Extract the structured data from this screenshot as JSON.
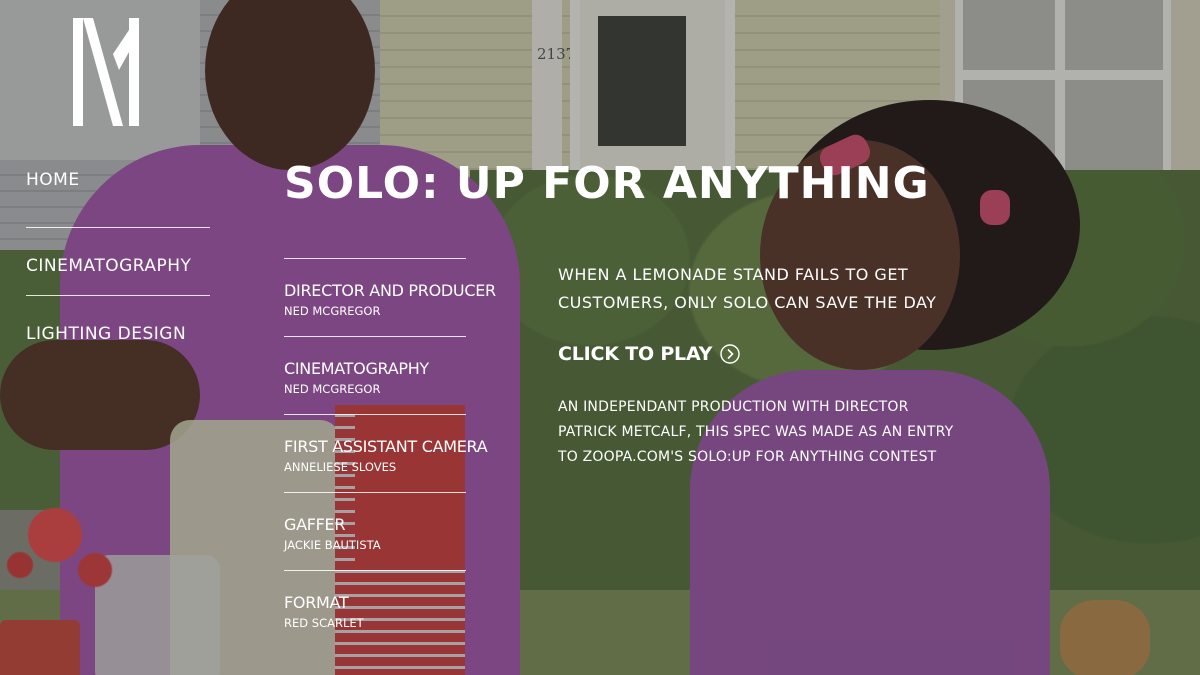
{
  "brand": {
    "logo_icon": "nm-monogram-logo"
  },
  "nav": {
    "items": [
      {
        "label": "HOME"
      },
      {
        "label": "CINEMATOGRAPHY"
      },
      {
        "label": "LIGHTING DESIGN"
      }
    ]
  },
  "project": {
    "title": "SOLO: UP FOR ANYTHING",
    "tagline": "WHEN A LEMONADE STAND FAILS TO GET CUSTOMERS, ONLY SOLO CAN SAVE THE DAY",
    "play_label": "CLICK TO PLAY",
    "play_icon": "chevron-right-circle-icon",
    "description": "AN INDEPENDANT PRODUCTION WITH DIRECTOR PATRICK METCALF, THIS SPEC WAS MADE AS AN ENTRY TO ZOOPA.COM'S SOLO:UP FOR ANYTHING CONTEST",
    "house_number": "2137"
  },
  "credits": [
    {
      "role": "DIRECTOR AND PRODUCER",
      "name": "NED MCGREGOR"
    },
    {
      "role": "CINEMATOGRAPHY",
      "name": "NED MCGREGOR"
    },
    {
      "role": "FIRST ASSISTANT CAMERA",
      "name": "ANNELIESE SLOVES"
    },
    {
      "role": "GAFFER",
      "name": "JACKIE BAUTISTA"
    },
    {
      "role": "FORMAT",
      "name": "RED SCARLET"
    }
  ],
  "colors": {
    "text": "#ffffff",
    "overlay": "rgba(36,36,40,0.32)",
    "shirt_purple": "#a556ad"
  }
}
